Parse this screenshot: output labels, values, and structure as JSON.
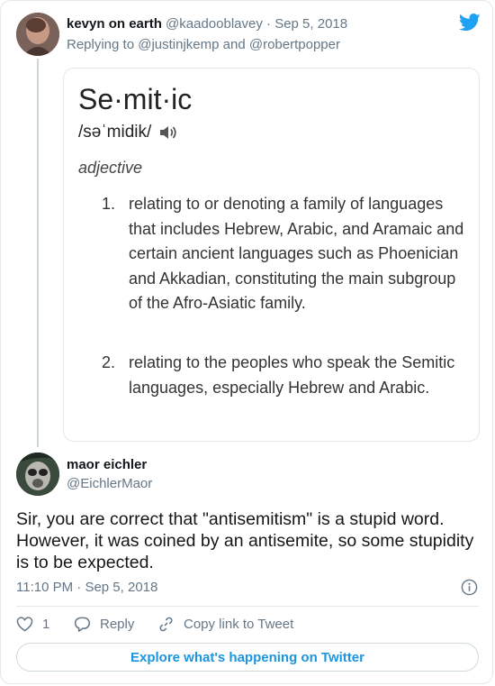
{
  "parent_tweet": {
    "name": "kevyn on earth",
    "handle": "@kaadooblavey",
    "separator": "·",
    "date": "Sep 5, 2018",
    "replying_prefix": "Replying to",
    "mention_1": "@justinjkemp",
    "conjunction": "and",
    "mention_2": "@robertpopper"
  },
  "dictionary": {
    "word": "Se·mit·ic",
    "pronunciation": "/səˈmidik/",
    "part_of_speech": "adjective",
    "definitions": [
      {
        "number": "1.",
        "text": "relating to or denoting a family of languages that includes Hebrew, Arabic, and Aramaic and certain ancient languages such as Phoenician and Akkadian, constituting the main subgroup of the Afro-Asiatic family."
      },
      {
        "number": "2.",
        "text": "relating to the peoples who speak the Semitic languages, especially Hebrew and Arabic."
      }
    ]
  },
  "main_tweet": {
    "name": "maor eichler",
    "handle": "@EichlerMaor",
    "text": "Sir, you are correct that \"antisemitism\" is a stupid word. However, it was coined by an antisemite, so some stupidity is to be expected.",
    "time": "11:10 PM",
    "separator": "·",
    "date": "Sep 5, 2018"
  },
  "actions": {
    "like_count": "1",
    "reply_label": "Reply",
    "copy_link_label": "Copy link to Tweet"
  },
  "explore_label": "Explore what's happening on Twitter",
  "colors": {
    "twitter_blue": "#1da1f2",
    "link_blue": "#1b95e0",
    "muted": "#657786",
    "border": "#e1e8ed"
  },
  "icons": {
    "brand": "twitter-bird-icon",
    "info": "info-icon",
    "like": "heart-icon",
    "reply": "reply-bubble-icon",
    "copy": "link-icon",
    "speaker": "speaker-icon"
  }
}
